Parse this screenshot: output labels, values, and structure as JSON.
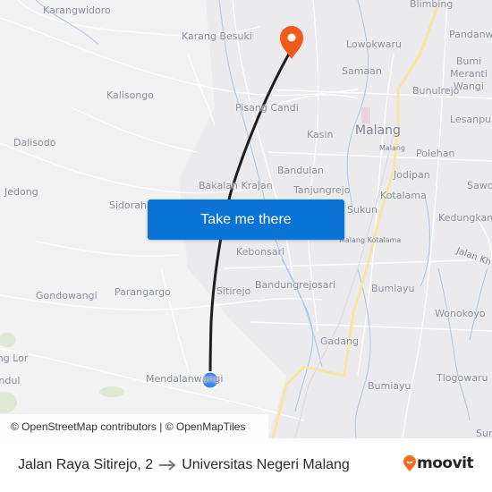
{
  "map": {
    "places": [
      {
        "name": "Karangwidoro",
        "style": "normal"
      },
      {
        "name": "Karang Besuki",
        "style": "normal"
      },
      {
        "name": "Blimbing",
        "style": "normal"
      },
      {
        "name": "Lowokwaru",
        "style": "normal"
      },
      {
        "name": "Pandanwangi",
        "style": "normal"
      },
      {
        "name": "Samaan",
        "style": "normal"
      },
      {
        "name": "Bumi Meranti Wangi",
        "style": "normal"
      },
      {
        "name": "Kalisongo",
        "style": "normal"
      },
      {
        "name": "Bunulrejo",
        "style": "normal"
      },
      {
        "name": "Pisang Candi",
        "style": "normal"
      },
      {
        "name": "Lesanpuro",
        "style": "normal"
      },
      {
        "name": "Dalisodo",
        "style": "normal"
      },
      {
        "name": "Kasin",
        "style": "normal"
      },
      {
        "name": "Malang",
        "style": "big"
      },
      {
        "name": "Malang",
        "style": "small"
      },
      {
        "name": "Polehan",
        "style": "normal"
      },
      {
        "name": "Bandulan",
        "style": "normal"
      },
      {
        "name": "Jodipan",
        "style": "normal"
      },
      {
        "name": "Jedong",
        "style": "normal"
      },
      {
        "name": "Bakalan Krajan",
        "style": "normal"
      },
      {
        "name": "Tanjungrejo",
        "style": "normal"
      },
      {
        "name": "Kotalama",
        "style": "normal"
      },
      {
        "name": "Sawojajar",
        "style": "normal"
      },
      {
        "name": "Sidorahayu",
        "style": "normal"
      },
      {
        "name": "Sukun",
        "style": "normal"
      },
      {
        "name": "Kedungkandang",
        "style": "normal"
      },
      {
        "name": "Malang Kotalama",
        "style": "small"
      },
      {
        "name": "Jalan Kh",
        "style": "road"
      },
      {
        "name": "Kebonsari",
        "style": "normal"
      },
      {
        "name": "Gondowangi",
        "style": "normal"
      },
      {
        "name": "Parangargo",
        "style": "normal"
      },
      {
        "name": "Sitirejo",
        "style": "normal"
      },
      {
        "name": "Bandungrejosari",
        "style": "normal"
      },
      {
        "name": "Bumiayu",
        "style": "normal"
      },
      {
        "name": "Wonokoyo",
        "style": "normal"
      },
      {
        "name": "Gadang",
        "style": "normal"
      },
      {
        "name": "Jedong Lor",
        "style": "normal"
      },
      {
        "name": "Mendalanwangi",
        "style": "normal"
      },
      {
        "name": "Bumiayu",
        "style": "normal"
      },
      {
        "name": "Tlogowaru",
        "style": "normal"
      },
      {
        "name": "Kendul",
        "style": "normal"
      },
      {
        "name": "Sumber",
        "style": "normal"
      }
    ],
    "origin_icon": "origin-dot-icon",
    "destination_icon": "destination-pin-icon",
    "colors": {
      "route": "#1f1f1f",
      "origin": "#3d82f2",
      "destination": "#f05a1a",
      "highway": "#f6e6a2",
      "water": "#a9c6e8",
      "park": "#d5e2c2"
    }
  },
  "cta": {
    "label": "Take me there",
    "color": "#0a73d6"
  },
  "attribution": {
    "text": "© OpenStreetMap contributors | © OpenMapTiles"
  },
  "footer": {
    "origin": "Jalan Raya Sitirejo, 2",
    "arrow_icon": "arrow-right-icon",
    "destination": "Universitas Negeri Malang",
    "brand": "moovit",
    "brand_color": "#f26c21"
  }
}
